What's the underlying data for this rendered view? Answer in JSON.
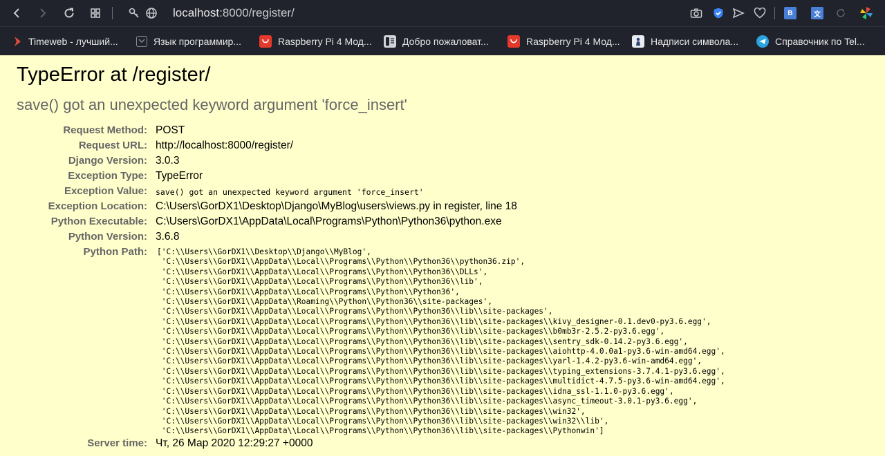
{
  "browser": {
    "url_host": "localhost",
    "url_rest": ":8000/register/",
    "bookmarks": [
      {
        "label": "Timeweb - лучший...",
        "icon": "timeweb-icon"
      },
      {
        "label": "Язык программир...",
        "icon": "document-icon"
      },
      {
        "label": "Raspberry Pi 4 Мод...",
        "icon": "aliexpress-icon"
      },
      {
        "label": "Добро пожаловат...",
        "icon": "page-icon"
      },
      {
        "label": "Raspberry Pi 4 Мод...",
        "icon": "aliexpress-icon"
      },
      {
        "label": "Надписи символа...",
        "icon": "chess-icon"
      },
      {
        "label": "Справочник по Tel...",
        "icon": "telegram-icon"
      }
    ],
    "colors": {
      "chrome_bg": "#20232b",
      "page_bg": "#ffffcc"
    }
  },
  "error": {
    "title": "TypeError at /register/",
    "message": "save() got an unexpected keyword argument 'force_insert'",
    "details": [
      {
        "label": "Request Method:",
        "value": "POST",
        "mono": false
      },
      {
        "label": "Request URL:",
        "value": "http://localhost:8000/register/",
        "mono": false
      },
      {
        "label": "Django Version:",
        "value": "3.0.3",
        "mono": false
      },
      {
        "label": "Exception Type:",
        "value": "TypeError",
        "mono": false
      },
      {
        "label": "Exception Value:",
        "value": "save() got an unexpected keyword argument 'force_insert'",
        "mono": true
      },
      {
        "label": "Exception Location:",
        "value": "C:\\Users\\GorDX1\\Desktop\\Django\\MyBlog\\users\\views.py in register, line 18",
        "mono": false
      },
      {
        "label": "Python Executable:",
        "value": "C:\\Users\\GorDX1\\AppData\\Local\\Programs\\Python\\Python36\\python.exe",
        "mono": false
      },
      {
        "label": "Python Version:",
        "value": "3.6.8",
        "mono": false
      }
    ],
    "python_path_label": "Python Path:",
    "python_path": [
      "['C:\\\\Users\\\\GorDX1\\\\Desktop\\\\Django\\\\MyBlog',",
      " 'C:\\\\Users\\\\GorDX1\\\\AppData\\\\Local\\\\Programs\\\\Python\\\\Python36\\\\python36.zip',",
      " 'C:\\\\Users\\\\GorDX1\\\\AppData\\\\Local\\\\Programs\\\\Python\\\\Python36\\\\DLLs',",
      " 'C:\\\\Users\\\\GorDX1\\\\AppData\\\\Local\\\\Programs\\\\Python\\\\Python36\\\\lib',",
      " 'C:\\\\Users\\\\GorDX1\\\\AppData\\\\Local\\\\Programs\\\\Python\\\\Python36',",
      " 'C:\\\\Users\\\\GorDX1\\\\AppData\\\\Roaming\\\\Python\\\\Python36\\\\site-packages',",
      " 'C:\\\\Users\\\\GorDX1\\\\AppData\\\\Local\\\\Programs\\\\Python\\\\Python36\\\\lib\\\\site-packages',",
      " 'C:\\\\Users\\\\GorDX1\\\\AppData\\\\Local\\\\Programs\\\\Python\\\\Python36\\\\lib\\\\site-packages\\\\kivy_designer-0.1.dev0-py3.6.egg',",
      " 'C:\\\\Users\\\\GorDX1\\\\AppData\\\\Local\\\\Programs\\\\Python\\\\Python36\\\\lib\\\\site-packages\\\\b0mb3r-2.5.2-py3.6.egg',",
      " 'C:\\\\Users\\\\GorDX1\\\\AppData\\\\Local\\\\Programs\\\\Python\\\\Python36\\\\lib\\\\site-packages\\\\sentry_sdk-0.14.2-py3.6.egg',",
      " 'C:\\\\Users\\\\GorDX1\\\\AppData\\\\Local\\\\Programs\\\\Python\\\\Python36\\\\lib\\\\site-packages\\\\aiohttp-4.0.0a1-py3.6-win-amd64.egg',",
      " 'C:\\\\Users\\\\GorDX1\\\\AppData\\\\Local\\\\Programs\\\\Python\\\\Python36\\\\lib\\\\site-packages\\\\yarl-1.4.2-py3.6-win-amd64.egg',",
      " 'C:\\\\Users\\\\GorDX1\\\\AppData\\\\Local\\\\Programs\\\\Python\\\\Python36\\\\lib\\\\site-packages\\\\typing_extensions-3.7.4.1-py3.6.egg',",
      " 'C:\\\\Users\\\\GorDX1\\\\AppData\\\\Local\\\\Programs\\\\Python\\\\Python36\\\\lib\\\\site-packages\\\\multidict-4.7.5-py3.6-win-amd64.egg',",
      " 'C:\\\\Users\\\\GorDX1\\\\AppData\\\\Local\\\\Programs\\\\Python\\\\Python36\\\\lib\\\\site-packages\\\\idna_ssl-1.1.0-py3.6.egg',",
      " 'C:\\\\Users\\\\GorDX1\\\\AppData\\\\Local\\\\Programs\\\\Python\\\\Python36\\\\lib\\\\site-packages\\\\async_timeout-3.0.1-py3.6.egg',",
      " 'C:\\\\Users\\\\GorDX1\\\\AppData\\\\Local\\\\Programs\\\\Python\\\\Python36\\\\lib\\\\site-packages\\\\win32',",
      " 'C:\\\\Users\\\\GorDX1\\\\AppData\\\\Local\\\\Programs\\\\Python\\\\Python36\\\\lib\\\\site-packages\\\\win32\\\\lib',",
      " 'C:\\\\Users\\\\GorDX1\\\\AppData\\\\Local\\\\Programs\\\\Python\\\\Python36\\\\lib\\\\site-packages\\\\Pythonwin']"
    ],
    "server_time_label": "Server time:",
    "server_time": "Чт, 26 Мар 2020 12:29:27 +0000"
  }
}
